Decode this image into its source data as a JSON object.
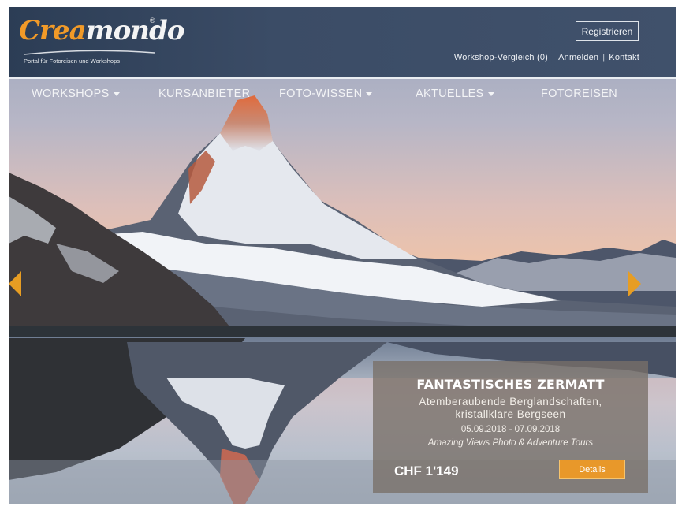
{
  "brand": {
    "logo_part1": "Crea",
    "logo_part2": "mondo",
    "registered_mark": "®",
    "tagline": "Portal für Fotoreisen und Workshops"
  },
  "header": {
    "register_label": "Registrieren",
    "links": [
      {
        "label": "Workshop-Vergleich (0)"
      },
      {
        "label": "Anmelden"
      },
      {
        "label": "Kontakt"
      }
    ],
    "separator": "|"
  },
  "nav": {
    "items": [
      {
        "label": "WORKSHOPS",
        "has_dropdown": true
      },
      {
        "label": "KURSANBIETER",
        "has_dropdown": false
      },
      {
        "label": "FOTO-WISSEN",
        "has_dropdown": true
      },
      {
        "label": "AKTUELLES",
        "has_dropdown": true
      },
      {
        "label": "FOTOREISEN",
        "has_dropdown": false
      }
    ]
  },
  "slider": {
    "prev_icon": "chevron-left-icon",
    "next_icon": "chevron-right-icon",
    "accent_color": "#e79d23"
  },
  "promo": {
    "title": "FANTASTISCHES ZERMATT",
    "subtitle_line1": "Atemberaubende Berglandschaften,",
    "subtitle_line2": "kristallklare Bergseen",
    "dates": "05.09.2018 - 07.09.2018",
    "organizer": "Amazing Views Photo & Adventure Tours",
    "price": "CHF 1'149",
    "details_label": "Details"
  }
}
